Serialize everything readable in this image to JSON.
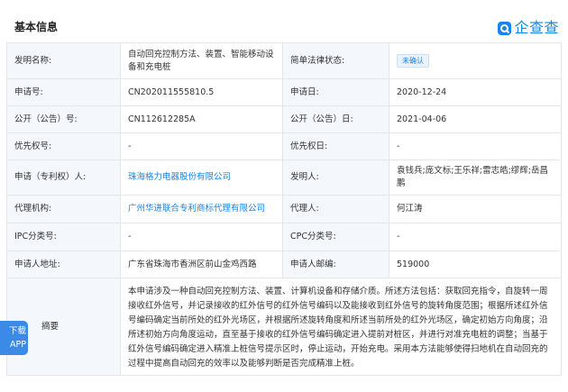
{
  "header": {
    "title": "基本信息",
    "logo_text": "企查查",
    "logo_icon": "qcc-search-icon"
  },
  "rows": [
    {
      "label": "发明名称:",
      "value": "自动回充控制方法、装置、智能移动设备和充电桩",
      "label2": "简单法律状态:",
      "badge": "未确认"
    },
    {
      "label": "申请号:",
      "value": "CN202011555810.5",
      "label2": "申请日:",
      "value2": "2020-12-24"
    },
    {
      "label": "公开（公告）号:",
      "value": "CN112612285A",
      "label2": "公开（公告）日:",
      "value2": "2021-04-06"
    },
    {
      "label": "优先权号:",
      "value": "-",
      "label2": "优先权日:",
      "value2": "-"
    },
    {
      "label": "申请（专利权）人:",
      "value": "珠海格力电器股份有限公司",
      "label2": "发明人:",
      "value2": "袁钱兵;庞文标;王乐祥;雷志皓;缪辉;岳昌鹏"
    },
    {
      "label": "代理机构:",
      "value": "广州华进联合专利商标代理有限公司",
      "label2": "代理人:",
      "value2": "何江涛"
    },
    {
      "label": "IPC分类号:",
      "value": "-",
      "label2": "CPC分类号:",
      "value2": "-"
    },
    {
      "label": "申请人地址:",
      "value": "广东省珠海市香洲区前山金鸡西路",
      "label2": "申请人邮编:",
      "value2": "519000"
    },
    {
      "label": "摘要",
      "value": "本申请涉及一种自动回充控制方法、装置、计算机设备和存储介质。所述方法包括：获取回充指令，自旋转一周接收红外信号，并记录接收的红外信号的红外信号编码以及能接收到红外信号的旋转角度范围；根据所述红外信号编码确定当前所处的红外光场区，并根据所述旋转角度和所述当前所处的红外光场区，确定初始方向角度；沿所述初始方向角度运动，直至基于接收的红外信号编码确定进入提前对桩区，并进行对准充电桩的调整；当基于红外信号编码确定进入精准上桩信号提示区时，停止运动，开始充电。采用本方法能够使得扫地机在自动回充的过程中提高自动回充的效率以及能够判断是否完成精准上桩。"
    }
  ],
  "app_tab": {
    "line1": "下载",
    "line2": "APP"
  }
}
